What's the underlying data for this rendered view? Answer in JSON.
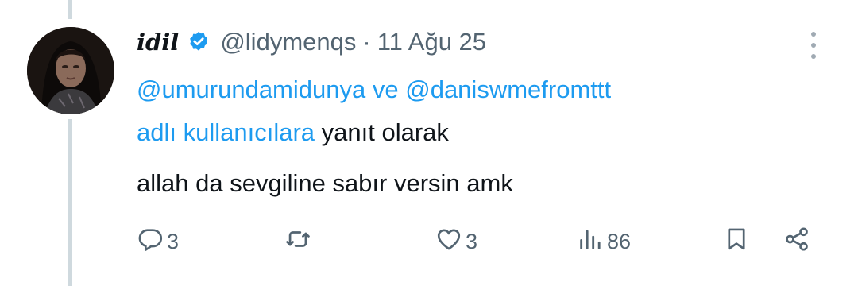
{
  "tweet": {
    "display_name": "idil",
    "handle": "@lidymenqs",
    "separator": "·",
    "date": "11 Ağu 25",
    "reply_mention_1": "@umurundamidunya",
    "reply_connector": "ve",
    "reply_mention_2": "@daniswmefromttt",
    "reply_users_link": "adlı kullanıcılara",
    "reply_suffix": "yanıt olarak",
    "text": "allah da sevgiline sabır versin amk"
  },
  "actions": {
    "reply_count": "3",
    "retweet_count": "",
    "like_count": "3",
    "views_count": "86"
  },
  "colors": {
    "accent": "#1d9bf0",
    "text": "#0f1419",
    "secondary": "#536471",
    "thread_line": "#cfd9de"
  },
  "icons": [
    "verified-badge-icon",
    "more-options-icon",
    "reply-icon",
    "retweet-icon",
    "like-icon",
    "views-icon",
    "bookmark-icon",
    "share-icon"
  ]
}
